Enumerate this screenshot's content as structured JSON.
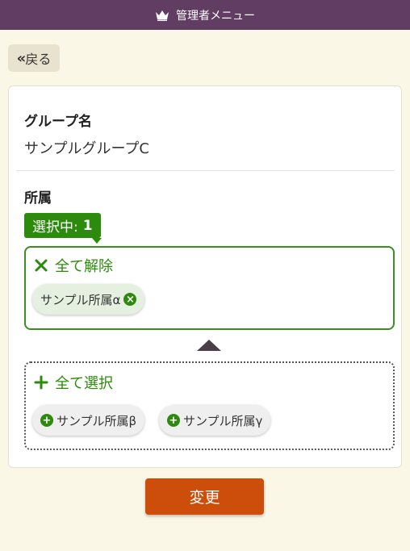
{
  "header": {
    "title": "管理者メニュー",
    "icon": "crown-icon"
  },
  "back_button": {
    "label": "戻る"
  },
  "group": {
    "name_label": "グループ名",
    "name_value": "サンプルグループC"
  },
  "affiliation": {
    "label": "所属",
    "selected_count_label": "選択中:",
    "selected_count": "1",
    "clear_all_label": "全て解除",
    "select_all_label": "全て選択",
    "selected_items": [
      "サンプル所属α"
    ],
    "available_items": [
      "サンプル所属β",
      "サンプル所属γ"
    ]
  },
  "submit_button": {
    "label": "変更"
  },
  "colors": {
    "header": "#613d63",
    "accent_green": "#2c8a0c",
    "submit": "#cc4e0a",
    "background": "#fbf7e6"
  }
}
